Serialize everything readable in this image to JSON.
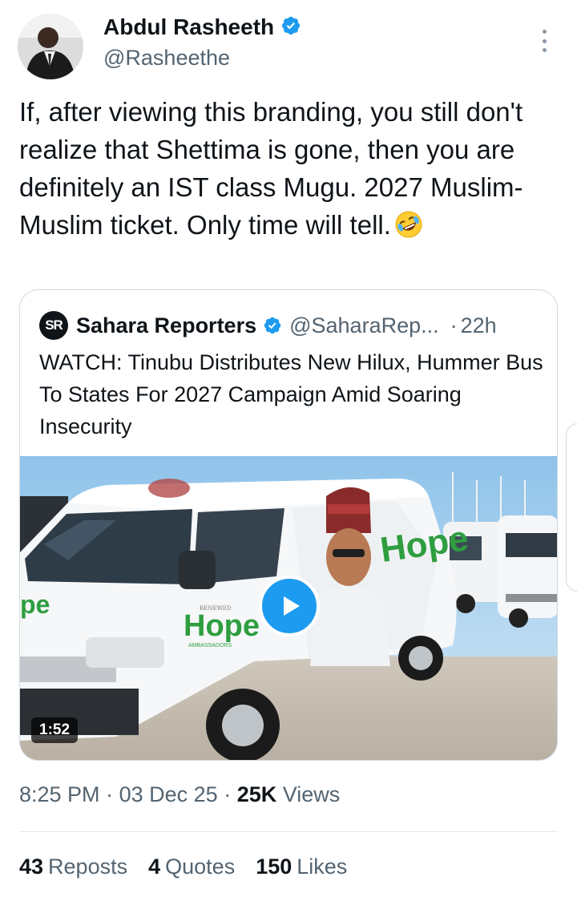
{
  "author": {
    "display_name": "Abdul Rasheeth",
    "handle": "@Rasheethe",
    "verified_icon": "verified-badge-icon"
  },
  "tweet": {
    "text": "If, after viewing this branding, you still don't realize that Shettima is gone, then you are definitely an IST class Mugu. 2027 Muslim-Muslim ticket. Only time will tell.",
    "emoji": "rolling-on-floor-laughing-emoji"
  },
  "quote": {
    "logo_text": "SR",
    "name": "Sahara Reporters",
    "handle": "@SaharaRep...",
    "separator": "·",
    "time": "22h",
    "text": "WATCH: Tinubu Distributes New Hilux, Hummer Bus To States For 2027 Campaign Amid Soaring Insecurity",
    "video": {
      "duration": "1:52",
      "van_brand_text": "Hope",
      "van_brand_sub": "AMBASSADORS",
      "van_brand_top": "RENEWED"
    }
  },
  "meta": {
    "time": "8:25 PM",
    "date": "03 Dec 25",
    "sep": "·",
    "views_count": "25K",
    "views_label": "Views"
  },
  "stats": {
    "reposts_count": "43",
    "reposts_label": "Reposts",
    "quotes_count": "4",
    "quotes_label": "Quotes",
    "likes_count": "150",
    "likes_label": "Likes"
  },
  "colors": {
    "accent": "#1d9bf0",
    "text": "#0f1419",
    "muted": "#536471",
    "border": "#cfd9de",
    "brand_green": "#2e9e3f"
  }
}
